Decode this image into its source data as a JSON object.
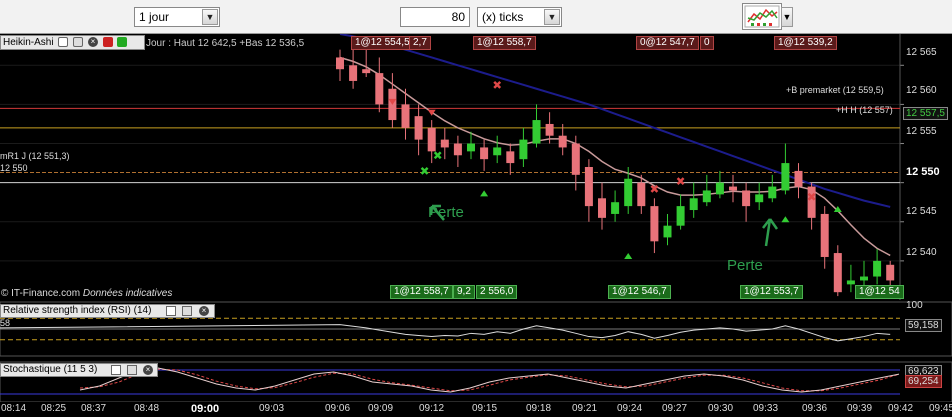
{
  "toolbar": {
    "timeframe": "1 jour",
    "units_value": "80",
    "units_type": "(x) ticks",
    "chart_icon": "chart-candles-icon"
  },
  "main_panel": {
    "title": "Heikin-Ashi",
    "info": "Jour : Haut 12 642,5 +Bas 12 536,5",
    "watermark_brand": "© IT-Finance.com",
    "watermark_note": "Données indicatives",
    "price_ticks": [
      "12 565",
      "12 560",
      "12 555",
      "12 550",
      "12 545",
      "12 540"
    ],
    "current_price_main": "12 550",
    "price_badge_high": "12 557,5",
    "lines": {
      "premarket": "+B premarket (12 559,5)",
      "high": "+H H (12 557)",
      "mr1": "mR1 J (12 551,3)",
      "level": "12 550"
    },
    "sell_boxes": [
      "1@12 554,5",
      "2,7",
      "1@12 558,7",
      "0@12 547,7",
      "0",
      "1@12 539,2"
    ],
    "buy_boxes": [
      "1@12 558,7",
      "9,2",
      "2 556,0",
      "1@12 546,7",
      "1@12 553,7",
      "1@12 54"
    ],
    "annotations": [
      "Perte",
      "Perte"
    ]
  },
  "rsi_panel": {
    "title": "Relative strength index (RSI) (14)",
    "value": "59,158",
    "level_label": "100",
    "left_tick": "58"
  },
  "stoch_panel": {
    "title": "Stochastique (11 5 3)",
    "value_1": "69,623",
    "value_2": "69,254"
  },
  "x_axis": [
    "08:14",
    "08:25",
    "08:37",
    "08:48",
    "09:00",
    "09:03",
    "09:06",
    "09:09",
    "09:12",
    "09:15",
    "09:18",
    "09:21",
    "09:24",
    "09:27",
    "09:30",
    "09:33",
    "09:36",
    "09:39",
    "09:42",
    "09:45"
  ],
  "colors": {
    "bull": "#33cc33",
    "bear": "#e8737a",
    "ma_fast": "#c89a9a",
    "ma_slow": "#1c1c8c",
    "premarket_line": "#d03a3a",
    "high_line": "#c8a020",
    "mr1_line": "#b07030"
  },
  "chart_data": {
    "type": "candlestick",
    "price_range": [
      12536,
      12567
    ],
    "candles": [
      {
        "o": 12566.0,
        "c": 12564.5,
        "h": 12567.0,
        "l": 12563.0
      },
      {
        "o": 12565.0,
        "c": 12563.0,
        "h": 12567.0,
        "l": 12562.0
      },
      {
        "o": 12564.5,
        "c": 12564.0,
        "h": 12567.0,
        "l": 12563.5
      },
      {
        "o": 12564.0,
        "c": 12560.0,
        "h": 12566.0,
        "l": 12559.0
      },
      {
        "o": 12562.0,
        "c": 12558.0,
        "h": 12564.0,
        "l": 12557.0
      },
      {
        "o": 12560.0,
        "c": 12557.0,
        "h": 12562.0,
        "l": 12555.5
      },
      {
        "o": 12558.5,
        "c": 12555.5,
        "h": 12560.0,
        "l": 12553.5
      },
      {
        "o": 12557.0,
        "c": 12554.0,
        "h": 12558.0,
        "l": 12552.5
      },
      {
        "o": 12555.5,
        "c": 12554.5,
        "h": 12557.0,
        "l": 12553.0
      },
      {
        "o": 12555.0,
        "c": 12553.5,
        "h": 12556.0,
        "l": 12552.0
      },
      {
        "o": 12554.0,
        "c": 12555.0,
        "h": 12556.5,
        "l": 12553.0
      },
      {
        "o": 12554.5,
        "c": 12553.0,
        "h": 12555.5,
        "l": 12551.5
      },
      {
        "o": 12553.5,
        "c": 12554.5,
        "h": 12556.0,
        "l": 12552.5
      },
      {
        "o": 12554.0,
        "c": 12552.5,
        "h": 12555.0,
        "l": 12551.0
      },
      {
        "o": 12553.0,
        "c": 12555.5,
        "h": 12557.0,
        "l": 12552.0
      },
      {
        "o": 12555.0,
        "c": 12558.0,
        "h": 12560.0,
        "l": 12554.5
      },
      {
        "o": 12557.5,
        "c": 12556.0,
        "h": 12559.0,
        "l": 12555.0
      },
      {
        "o": 12556.0,
        "c": 12554.5,
        "h": 12557.5,
        "l": 12553.5
      },
      {
        "o": 12555.0,
        "c": 12551.0,
        "h": 12556.0,
        "l": 12549.0
      },
      {
        "o": 12552.0,
        "c": 12547.0,
        "h": 12553.0,
        "l": 12545.0
      },
      {
        "o": 12548.0,
        "c": 12545.5,
        "h": 12550.0,
        "l": 12544.0
      },
      {
        "o": 12546.0,
        "c": 12547.5,
        "h": 12549.0,
        "l": 12545.0
      },
      {
        "o": 12547.0,
        "c": 12550.5,
        "h": 12552.0,
        "l": 12546.0
      },
      {
        "o": 12550.0,
        "c": 12547.0,
        "h": 12551.0,
        "l": 12546.0
      },
      {
        "o": 12547.0,
        "c": 12542.5,
        "h": 12548.0,
        "l": 12541.0
      },
      {
        "o": 12543.0,
        "c": 12544.5,
        "h": 12546.0,
        "l": 12542.0
      },
      {
        "o": 12544.5,
        "c": 12547.0,
        "h": 12548.5,
        "l": 12544.0
      },
      {
        "o": 12546.5,
        "c": 12548.0,
        "h": 12550.0,
        "l": 12545.5
      },
      {
        "o": 12547.5,
        "c": 12549.0,
        "h": 12551.0,
        "l": 12547.0
      },
      {
        "o": 12548.5,
        "c": 12550.0,
        "h": 12551.5,
        "l": 12548.0
      },
      {
        "o": 12549.5,
        "c": 12549.0,
        "h": 12551.0,
        "l": 12547.5
      },
      {
        "o": 12549.0,
        "c": 12547.0,
        "h": 12550.0,
        "l": 12545.0
      },
      {
        "o": 12547.5,
        "c": 12548.5,
        "h": 12550.0,
        "l": 12546.5
      },
      {
        "o": 12548.0,
        "c": 12549.5,
        "h": 12551.0,
        "l": 12547.5
      },
      {
        "o": 12549.0,
        "c": 12552.5,
        "h": 12555.0,
        "l": 12548.5
      },
      {
        "o": 12551.5,
        "c": 12549.5,
        "h": 12552.5,
        "l": 12548.0
      },
      {
        "o": 12549.5,
        "c": 12545.5,
        "h": 12550.0,
        "l": 12544.0
      },
      {
        "o": 12546.0,
        "c": 12540.5,
        "h": 12547.0,
        "l": 12539.0
      },
      {
        "o": 12541.0,
        "c": 12536.0,
        "h": 12542.0,
        "l": 12535.5
      },
      {
        "o": 12537.0,
        "c": 12537.5,
        "h": 12539.5,
        "l": 12536.0
      },
      {
        "o": 12537.5,
        "c": 12538.0,
        "h": 12540.0,
        "l": 12536.5
      },
      {
        "o": 12538.0,
        "c": 12540.0,
        "h": 12541.5,
        "l": 12537.0
      },
      {
        "o": 12539.5,
        "c": 12537.5,
        "h": 12540.0,
        "l": 12536.5
      }
    ],
    "ma_fast": [
      12566,
      12565.5,
      12564.8,
      12563.8,
      12562.6,
      12561.4,
      12560.2,
      12559.0,
      12557.9,
      12557.0,
      12556.3,
      12555.6,
      12555.1,
      12554.8,
      12554.9,
      12555.3,
      12555.6,
      12555.6,
      12555.0,
      12554.0,
      12552.7,
      12551.7,
      12551.2,
      12550.6,
      12549.6,
      12548.8,
      12548.4,
      12548.4,
      12548.5,
      12548.7,
      12548.9,
      12548.8,
      12548.8,
      12548.9,
      12549.3,
      12549.5,
      12549.1,
      12548.0,
      12546.4,
      12544.6,
      12542.9,
      12541.6,
      12540.7
    ],
    "ma_slow": [
      12569.0,
      12568.7,
      12568.4,
      12568.0,
      12567.5,
      12567.0,
      12566.5,
      12566.0,
      12565.5,
      12565.0,
      12564.5,
      12564.0,
      12563.5,
      12563.0,
      12562.5,
      12562.0,
      12561.5,
      12561.0,
      12560.5,
      12560.0,
      12559.4,
      12558.8,
      12558.2,
      12557.6,
      12557.0,
      12556.4,
      12555.8,
      12555.2,
      12554.6,
      12554.0,
      12553.4,
      12552.8,
      12552.2,
      12551.6,
      12551.0,
      12550.4,
      12549.8,
      12549.2,
      12548.7,
      12548.2,
      12547.7,
      12547.3,
      12546.9
    ],
    "rsi": [
      58,
      55,
      52,
      48,
      44,
      40,
      38,
      36,
      38,
      37,
      42,
      40,
      45,
      42,
      50,
      56,
      52,
      48,
      42,
      36,
      34,
      38,
      45,
      40,
      33,
      38,
      44,
      48,
      50,
      52,
      50,
      46,
      48,
      50,
      56,
      50,
      42,
      34,
      28,
      32,
      36,
      42,
      40
    ],
    "stoch_k": [
      30,
      40,
      60,
      80,
      85,
      75,
      60,
      45,
      35,
      30,
      40,
      55,
      70,
      75,
      65,
      50,
      45,
      40,
      30,
      25,
      35,
      50,
      60,
      65,
      70,
      60,
      50,
      40,
      35,
      45,
      55,
      65,
      70,
      65,
      55,
      40,
      30,
      25,
      30,
      40,
      50,
      60,
      69.623
    ],
    "stoch_d": [
      35,
      38,
      50,
      70,
      82,
      80,
      68,
      52,
      40,
      33,
      36,
      48,
      62,
      72,
      70,
      57,
      48,
      42,
      35,
      28,
      30,
      42,
      55,
      62,
      68,
      65,
      55,
      45,
      38,
      40,
      50,
      60,
      67,
      67,
      60,
      48,
      35,
      28,
      28,
      35,
      45,
      55,
      69.254
    ]
  }
}
